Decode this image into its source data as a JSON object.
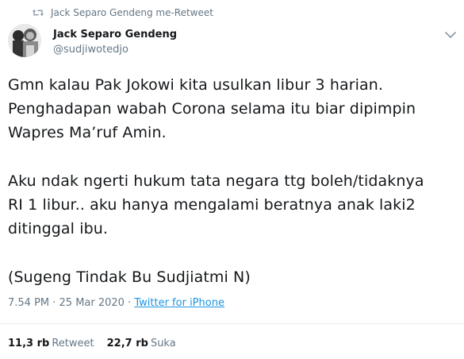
{
  "retweet": {
    "icon": "retweet-icon",
    "text": "Jack Separo Gendeng me-Retweet"
  },
  "author": {
    "display_name": "Jack Separo Gendeng",
    "handle": "@sudjiwotedjo"
  },
  "tweet": {
    "paragraphs": [
      [
        "Gmn kalau Pak Jokowi kita usulkan libur 3 harian.",
        "Penghadapan wabah Corona selama itu biar dipimpin",
        "Wapres Ma’ruf Amin."
      ],
      [
        "Aku ndak ngerti hukum tata negara ttg boleh/tidaknya",
        "RI 1 libur.. aku hanya mengalami beratnya anak laki2",
        "ditinggal ibu."
      ],
      [
        "(Sugeng Tindak Bu Sudjiatmi N)"
      ]
    ]
  },
  "meta": {
    "time": "7.54 PM · 25 Mar 2020 · ",
    "source": "Twitter for iPhone"
  },
  "stats": {
    "retweets_count": "11,3 rb",
    "retweets_label": "Retweet",
    "likes_count": "22,7 rb",
    "likes_label": "Suka"
  },
  "colors": {
    "secondary_text": "#657786",
    "link": "#1b95e0",
    "divider": "#e6ecf0"
  }
}
